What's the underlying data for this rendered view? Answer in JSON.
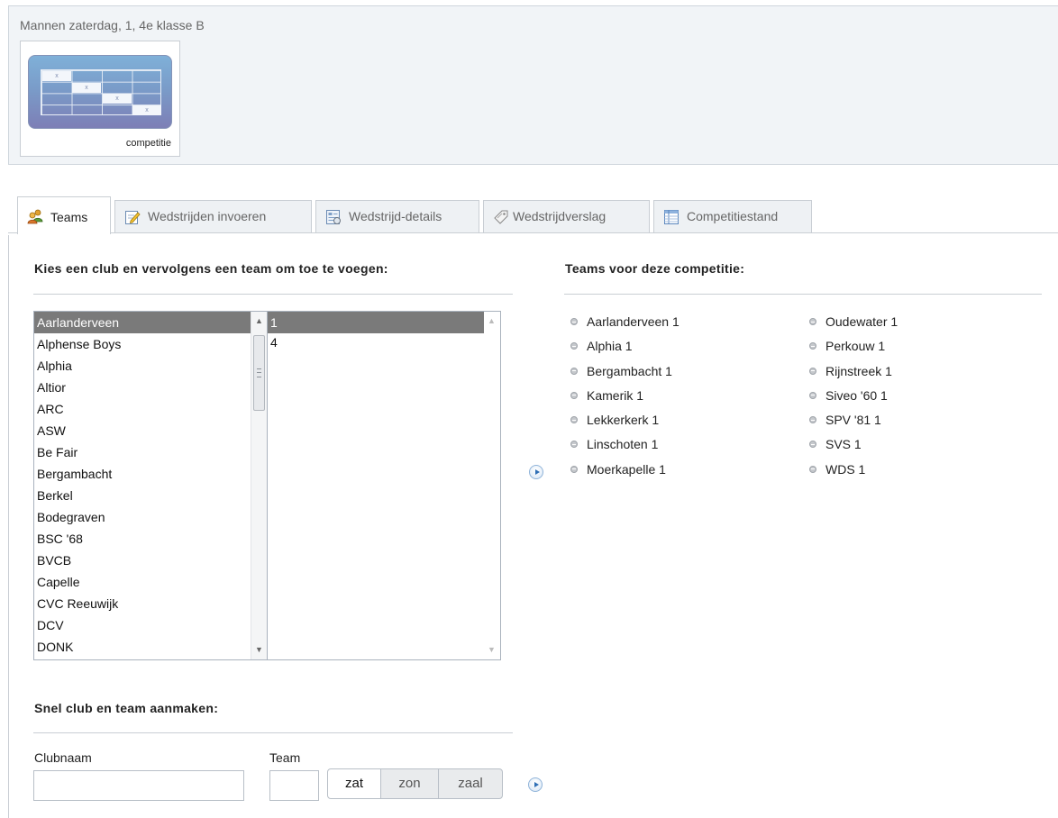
{
  "header": {
    "title": "Mannen zaterdag, 1, 4e klasse B",
    "competition_tile_label": "competitie",
    "grid_marks": [
      "x",
      "x",
      "x",
      "x"
    ]
  },
  "tabs": [
    {
      "label": "Teams",
      "icon": "users-icon",
      "active": true
    },
    {
      "label": "Wedstrijden invoeren",
      "icon": "edit-icon",
      "active": false
    },
    {
      "label": "Wedstrijd-details",
      "icon": "details-icon",
      "active": false
    },
    {
      "label": "Wedstrijdverslag",
      "icon": "tag-icon",
      "active": false
    },
    {
      "label": "Competitiestand",
      "icon": "table-icon",
      "active": false
    }
  ],
  "select_section": {
    "heading": "Kies een club en vervolgens een team om toe te voegen:",
    "clubs": [
      "Aarlanderveen",
      "Alphense Boys",
      "Alphia",
      "Altior",
      "ARC",
      "ASW",
      "Be Fair",
      "Bergambacht",
      "Berkel",
      "Bodegraven",
      "BSC '68",
      "BVCB",
      "Capelle",
      "CVC Reeuwijk",
      "DCV",
      "DONK"
    ],
    "selected_club": "Aarlanderveen",
    "teams": [
      "1",
      "4"
    ],
    "selected_team": "1"
  },
  "competition_teams": {
    "heading": "Teams voor deze competitie:",
    "column1": [
      "Aarlanderveen 1",
      "Alphia 1",
      "Bergambacht 1",
      "Kamerik 1",
      "Lekkerkerk 1",
      "Linschoten 1",
      "Moerkapelle 1"
    ],
    "column2": [
      "Oudewater 1",
      "Perkouw 1",
      "Rijnstreek 1",
      "Siveo '60 1",
      "SPV '81 1",
      "SVS 1",
      "WDS 1"
    ]
  },
  "quick_create": {
    "heading": "Snel club en team aanmaken:",
    "club_label": "Clubnaam",
    "club_value": "",
    "team_label": "Team",
    "team_value": "",
    "day_options": [
      "zat",
      "zon",
      "zaal"
    ],
    "selected_day": "zat"
  },
  "colors": {
    "selection": "#7a7a7a",
    "border": "#c9ced4",
    "topbar_bg": "#f1f4f7",
    "accent_blue": "#2f6fb5"
  }
}
